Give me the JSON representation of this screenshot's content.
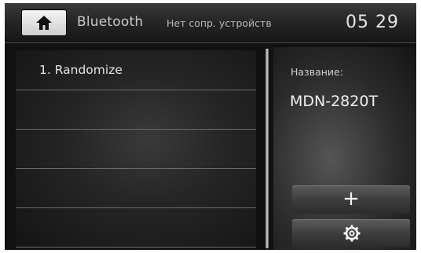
{
  "header": {
    "home_icon": "home-icon",
    "title": "Bluetooth",
    "status": "Нет сопр. устройств",
    "clock": "05 29"
  },
  "device_list": {
    "items": [
      {
        "label": "1. Randomize"
      },
      {
        "label": ""
      },
      {
        "label": ""
      },
      {
        "label": ""
      },
      {
        "label": ""
      }
    ]
  },
  "details": {
    "name_label": "Название:",
    "name_value": "MDN-2820T"
  },
  "actions": {
    "add_icon": "plus-icon",
    "add_glyph": "+",
    "settings_icon": "gear-icon"
  }
}
